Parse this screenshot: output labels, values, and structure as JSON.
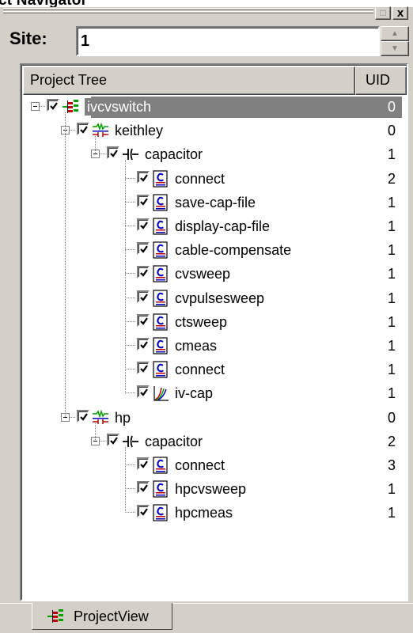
{
  "window": {
    "title": "ct Navigator",
    "close_glyph": "x",
    "maximize_glyph": "□"
  },
  "site": {
    "label": "Site:",
    "value": "1"
  },
  "tree": {
    "columns": {
      "name": "Project Tree",
      "uid": "UID"
    },
    "rows": [
      {
        "label": "ivcvswitch",
        "uid": "0",
        "icon": "project-icon",
        "depth": 0,
        "selected": true
      },
      {
        "label": "keithley",
        "uid": "0",
        "icon": "instrument-icon",
        "depth": 1
      },
      {
        "label": "capacitor",
        "uid": "1",
        "icon": "capacitor-icon",
        "depth": 2
      },
      {
        "label": "connect",
        "uid": "2",
        "icon": "script-icon",
        "depth": 3
      },
      {
        "label": "save-cap-file",
        "uid": "1",
        "icon": "script-icon",
        "depth": 3
      },
      {
        "label": "display-cap-file",
        "uid": "1",
        "icon": "script-icon",
        "depth": 3
      },
      {
        "label": "cable-compensate",
        "uid": "1",
        "icon": "script-icon",
        "depth": 3
      },
      {
        "label": "cvsweep",
        "uid": "1",
        "icon": "script-icon",
        "depth": 3
      },
      {
        "label": "cvpulsesweep",
        "uid": "1",
        "icon": "script-icon",
        "depth": 3
      },
      {
        "label": "ctsweep",
        "uid": "1",
        "icon": "script-icon",
        "depth": 3
      },
      {
        "label": "cmeas",
        "uid": "1",
        "icon": "script-icon",
        "depth": 3
      },
      {
        "label": "connect",
        "uid": "1",
        "icon": "script-icon",
        "depth": 3
      },
      {
        "label": "iv-cap",
        "uid": "1",
        "icon": "graph-icon",
        "depth": 3
      },
      {
        "label": "hp",
        "uid": "0",
        "icon": "instrument-icon",
        "depth": 1
      },
      {
        "label": "capacitor",
        "uid": "2",
        "icon": "capacitor-icon",
        "depth": 2
      },
      {
        "label": "connect",
        "uid": "3",
        "icon": "script-icon",
        "depth": 3
      },
      {
        "label": "hpcvsweep",
        "uid": "1",
        "icon": "script-icon",
        "depth": 3
      },
      {
        "label": "hpcmeas",
        "uid": "1",
        "icon": "script-icon",
        "depth": 3
      }
    ]
  },
  "tabs": [
    {
      "label": "ProjectView",
      "icon": "project-icon",
      "active": true
    }
  ],
  "colors": {
    "selection": "#808080",
    "chrome": "#d4d0c8",
    "project_icon_green": "#00a000",
    "project_icon_red": "#c00000",
    "script_icon_blue": "#0000c0"
  }
}
